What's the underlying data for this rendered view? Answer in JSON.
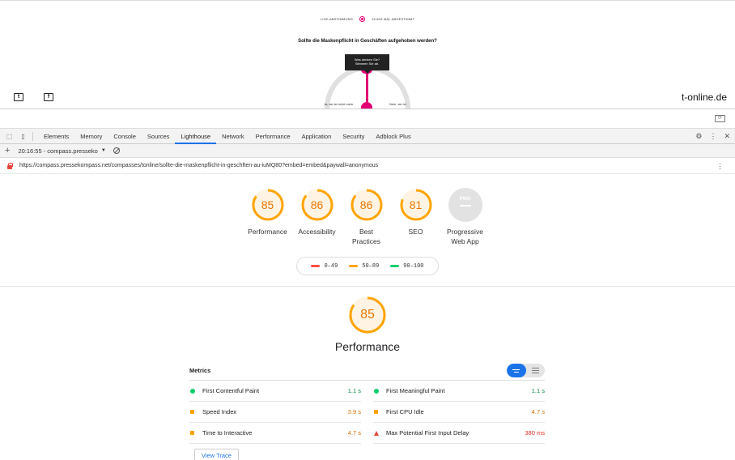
{
  "webpage": {
    "live_label": "LIVE-ABSTIMMUNG",
    "votes_label": "15.603 MAL ABGESTIMMT",
    "question": "Sollte die Maskenpflicht in Geschäften aufgehoben werden?",
    "tooltip_line1": "Was denken Sie?",
    "tooltip_line2": "Stimmen Sie ab.",
    "option_left": "Ja, sie ist nicht mehr",
    "option_right": "Nein, sie ist",
    "brand": "t-online.de",
    "twitter_glyph": "t",
    "facebook_glyph": "f",
    "accent_color": "#e20074"
  },
  "devtools": {
    "tabs": [
      "Elements",
      "Memory",
      "Console",
      "Sources",
      "Lighthouse",
      "Network",
      "Performance",
      "Application",
      "Security",
      "Adblock Plus"
    ],
    "active_tab": "Lighthouse",
    "report_selector": "20:16:55 - compass.presseko",
    "url": "https://compass.pressekompass.net/compasses/tonline/sollte-die-maskenpflicht-in-geschften-au-iuMQ80?embed=embed&paywall=anonymous"
  },
  "lighthouse": {
    "scores": [
      {
        "score": "85",
        "value": 85,
        "label_l1": "Performance",
        "label_l2": ""
      },
      {
        "score": "86",
        "value": 86,
        "label_l1": "Accessibility",
        "label_l2": ""
      },
      {
        "score": "86",
        "value": 86,
        "label_l1": "Best",
        "label_l2": "Practices"
      },
      {
        "score": "81",
        "value": 81,
        "label_l1": "SEO",
        "label_l2": ""
      }
    ],
    "pwa": {
      "badge": "PWA",
      "label_l1": "Progressive",
      "label_l2": "Web App"
    },
    "legend": [
      {
        "text": "0–49",
        "color": "#ff4e42"
      },
      {
        "text": "50–89",
        "color": "#ffa400"
      },
      {
        "text": "90–100",
        "color": "#0cce6b"
      }
    ],
    "perf_score": "85",
    "perf_value": 85,
    "perf_title": "Performance",
    "metrics_title": "Metrics",
    "metrics_left": [
      {
        "name": "First Contentful Paint",
        "value": "1.1 s",
        "status": "pass"
      },
      {
        "name": "Speed Index",
        "value": "3.9 s",
        "status": "average"
      },
      {
        "name": "Time to Interactive",
        "value": "4.7 s",
        "status": "average"
      }
    ],
    "metrics_right": [
      {
        "name": "First Meaningful Paint",
        "value": "1.1 s",
        "status": "pass"
      },
      {
        "name": "First CPU Idle",
        "value": "4.7 s",
        "status": "average"
      },
      {
        "name": "Max Potential First Input Delay",
        "value": "380 ms",
        "status": "fail"
      }
    ],
    "view_trace": "View Trace",
    "colors": {
      "average": "#ffa400",
      "pass": "#0cce6b",
      "fail": "#ff4e42"
    }
  }
}
